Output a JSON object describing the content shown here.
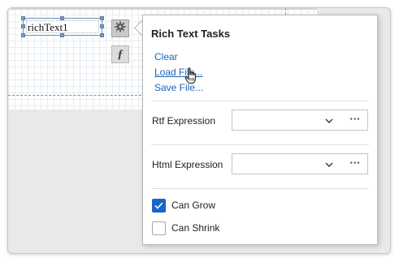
{
  "designer": {
    "control_label": "richText1"
  },
  "smart_tag": {
    "tasks_icon": "gear-icon",
    "expression_icon": "function-icon",
    "expression_glyph": "ƒ"
  },
  "panel": {
    "title": "Rich Text Tasks",
    "actions": [
      {
        "label": "Clear"
      },
      {
        "label": "Load File..."
      },
      {
        "label": "Save File..."
      }
    ],
    "rtf_expression": {
      "label": "Rtf Expression",
      "value": "",
      "ellipsis": "···"
    },
    "html_expression": {
      "label": "Html Expression",
      "value": "",
      "ellipsis": "···"
    },
    "can_grow": {
      "label": "Can Grow",
      "checked": true
    },
    "can_shrink": {
      "label": "Can Shrink",
      "checked": false
    }
  },
  "colors": {
    "link": "#1e63b4",
    "checkbox_accent": "#1a63c7"
  }
}
